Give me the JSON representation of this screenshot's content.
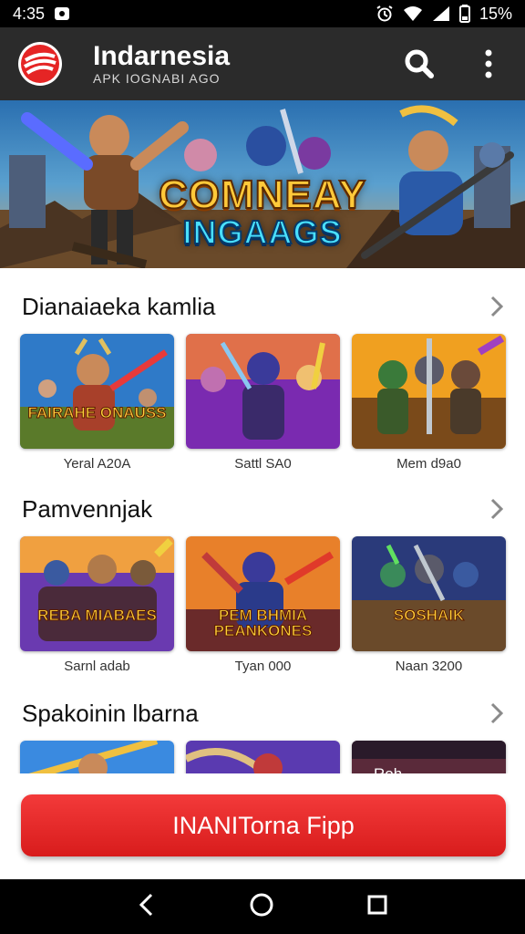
{
  "status_bar": {
    "time": "4:35",
    "battery": "15%"
  },
  "header": {
    "title": "Indarnesia",
    "subtitle": "APK IOGNABI AGO"
  },
  "hero": {
    "line1": "COMNEAY",
    "line2": "INGAAGS"
  },
  "sections": [
    {
      "title": "Dianaiaeka kamlia",
      "items": [
        {
          "thumb_text": "FAIRAHE ONAUSS",
          "label": "Yeral A20A"
        },
        {
          "thumb_text": "",
          "label": "Sattl SA0"
        },
        {
          "thumb_text": "",
          "label": "Mem d9a0"
        }
      ]
    },
    {
      "title": "Pamvennjak",
      "items": [
        {
          "thumb_text": "REBA MIABAES",
          "label": "Sarnl adab"
        },
        {
          "thumb_text": "PEM BHMIA PEANKONES",
          "label": "Tyan 000"
        },
        {
          "thumb_text": "SOSHAIK",
          "label": "Naan 3200"
        }
      ]
    },
    {
      "title": "Spakoinin lbarna",
      "items": [
        {
          "thumb_text": "",
          "label": ""
        },
        {
          "thumb_text": "",
          "label": ""
        },
        {
          "thumb_text": "Roh",
          "label": ""
        }
      ]
    }
  ],
  "install_button": "INANITorna Fipp",
  "colors": {
    "accent": "#e52525",
    "app_bar": "#2b2b2b"
  },
  "icons": [
    "logo-icon",
    "search-icon",
    "more-vert-icon",
    "chevron-right-icon",
    "back-icon",
    "home-icon",
    "recents-icon"
  ]
}
